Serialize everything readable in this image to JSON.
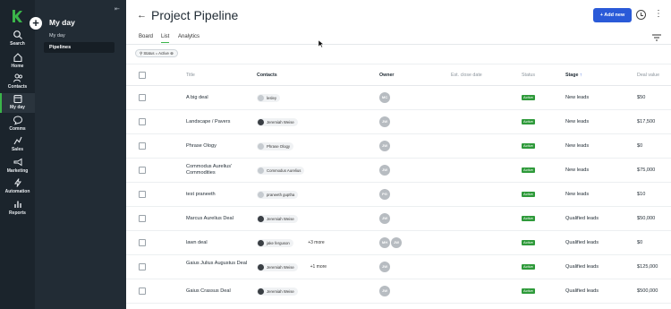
{
  "nav": {
    "items": [
      {
        "label": "Search",
        "icon": "search-icon"
      },
      {
        "label": "Home",
        "icon": "home-icon"
      },
      {
        "label": "Contacts",
        "icon": "contacts-icon"
      },
      {
        "label": "My day",
        "icon": "calendar-icon",
        "active": true
      },
      {
        "label": "Comms",
        "icon": "chat-icon"
      },
      {
        "label": "Sales",
        "icon": "sales-icon"
      },
      {
        "label": "Marketing",
        "icon": "megaphone-icon"
      },
      {
        "label": "Automation",
        "icon": "bolt-icon"
      },
      {
        "label": "Reports",
        "icon": "bar-chart-icon"
      }
    ],
    "accent": "#3bb54a"
  },
  "sidebar": {
    "title": "My day",
    "add_label": "+",
    "links": [
      "My day",
      "Pipelines"
    ],
    "active_link": "Pipelines"
  },
  "header": {
    "title": "Project Pipeline",
    "add_new": "+ Add new",
    "add_new_color": "#2a5ad8"
  },
  "tabs": [
    "Board",
    "List",
    "Analytics"
  ],
  "active_tab": "List",
  "filter_chip": "Status = Active",
  "table": {
    "columns": [
      "Title",
      "Contacts",
      "Owner",
      "Est. close date",
      "Status",
      "Stage",
      "Deal value"
    ],
    "sort_arrow": "↑",
    "rows": [
      {
        "title": "A big deal",
        "contact": "lesley",
        "contact_dark": false,
        "more": "",
        "owners": [
          "MC"
        ],
        "status": "Active",
        "stage": "New leads",
        "value": "$50"
      },
      {
        "title": "Landscape / Pavers",
        "contact": "Jeremiah Weise",
        "contact_dark": true,
        "more": "",
        "owners": [
          "JW"
        ],
        "status": "Active",
        "stage": "New leads",
        "value": "$17,500"
      },
      {
        "title": "Phrase Ology",
        "contact": "Phrase Ology",
        "contact_dark": false,
        "more": "",
        "owners": [
          "JW"
        ],
        "status": "Active",
        "stage": "New leads",
        "value": "$0"
      },
      {
        "title": "Commodus Aurelius' Commodities",
        "contact": "Commodus Aurelius",
        "contact_dark": false,
        "more": "",
        "owners": [
          "JW"
        ],
        "status": "Active",
        "stage": "New leads",
        "value": "$75,000"
      },
      {
        "title": "test praneeth",
        "contact": "praneeth guptha",
        "contact_dark": false,
        "more": "",
        "owners": [
          "PG"
        ],
        "status": "Active",
        "stage": "New leads",
        "value": "$10"
      },
      {
        "title": "Marcus Aurelius Deal",
        "contact": "Jeremiah Weise",
        "contact_dark": true,
        "more": "",
        "owners": [
          "JW"
        ],
        "status": "Active",
        "stage": "Qualified leads",
        "value": "$50,000"
      },
      {
        "title": "lawn deal",
        "contact": "jake ferguson",
        "contact_dark": true,
        "more": "+3 more",
        "owners": [
          "MH",
          "JW"
        ],
        "status": "Active",
        "stage": "Qualified leads",
        "value": "$0"
      },
      {
        "title": "Gaius Julius Augustus Deal",
        "contact": "Jeremiah Weise",
        "contact_dark": true,
        "more": "+1 more",
        "owners": [
          "JW"
        ],
        "status": "Active",
        "stage": "Qualified leads",
        "value": "$125,000"
      },
      {
        "title": "Gaius Crassus Deal",
        "contact": "Jeremiah Weise",
        "contact_dark": true,
        "more": "",
        "owners": [
          "JW"
        ],
        "status": "Active",
        "stage": "Qualified leads",
        "value": "$500,000"
      }
    ]
  }
}
